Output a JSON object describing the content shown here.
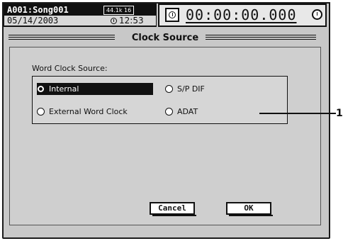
{
  "header": {
    "song_title": "A001:Song001",
    "sample_rate_badge": "44.1k 16",
    "date": "05/14/2003",
    "time": "12:53",
    "counter": "00:00:00.000"
  },
  "dialog": {
    "title": "Clock Source",
    "field_label": "Word Clock Source:",
    "options": [
      {
        "label": "Internal",
        "selected": true
      },
      {
        "label": "S/P DIF",
        "selected": false
      },
      {
        "label": "External Word Clock",
        "selected": false
      },
      {
        "label": "ADAT",
        "selected": false
      }
    ],
    "cancel_label": "Cancel",
    "ok_label": "OK"
  },
  "callout": {
    "number": "1"
  },
  "icons": [
    "clock-icon",
    "counter-icon",
    "alarm-icon"
  ]
}
